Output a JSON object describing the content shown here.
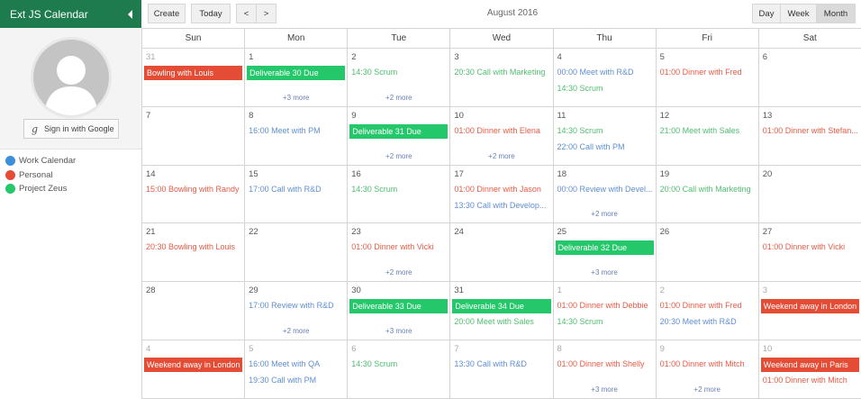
{
  "colors": {
    "work": "#3c8fd8",
    "personal": "#e44c36",
    "zeus": "#24c76a",
    "work_text": "#5f8fd0",
    "personal_text": "#e55b45",
    "zeus_text": "#4fbe6f"
  },
  "sidebar": {
    "title": "Ext JS Calendar",
    "collapse_icon": "caret-left-icon",
    "google_button": "Sign in with Google",
    "google_glyph": "g",
    "calendars": [
      {
        "label": "Work Calendar",
        "color": "#3c8fd8"
      },
      {
        "label": "Personal",
        "color": "#e44c36"
      },
      {
        "label": "Project Zeus",
        "color": "#24c76a"
      }
    ]
  },
  "toolbar": {
    "create": "Create",
    "today": "Today",
    "prev": "<",
    "next": ">",
    "title": "August 2016",
    "views": {
      "day": "Day",
      "week": "Week",
      "month": "Month"
    },
    "active_view": "Month"
  },
  "calendar": {
    "days_of_week": [
      "Sun",
      "Mon",
      "Tue",
      "Wed",
      "Thu",
      "Fri",
      "Sat"
    ],
    "weeks": [
      [
        {
          "day": "31",
          "other": true,
          "events": [
            {
              "title": "Bowling with Louis",
              "cal": "personal",
              "bar": true
            }
          ]
        },
        {
          "day": "1",
          "events": [
            {
              "title": "Deliverable 30 Due",
              "cal": "zeus",
              "bar": true
            }
          ],
          "more": "+3 more"
        },
        {
          "day": "2",
          "events": [
            {
              "title": "14:30 Scrum",
              "cal": "zeus"
            }
          ],
          "more": "+2 more"
        },
        {
          "day": "3",
          "events": [
            {
              "title": "20:30 Call with Marketing",
              "cal": "zeus"
            }
          ]
        },
        {
          "day": "4",
          "events": [
            {
              "title": "00:00 Meet with R&D",
              "cal": "work"
            },
            {
              "title": "14:30 Scrum",
              "cal": "zeus"
            }
          ]
        },
        {
          "day": "5",
          "events": [
            {
              "title": "01:00 Dinner with Fred",
              "cal": "personal"
            }
          ]
        },
        {
          "day": "6",
          "events": []
        }
      ],
      [
        {
          "day": "7",
          "events": []
        },
        {
          "day": "8",
          "events": [
            {
              "title": "16:00 Meet with PM",
              "cal": "work"
            }
          ]
        },
        {
          "day": "9",
          "events": [
            {
              "title": "Deliverable 31 Due",
              "cal": "zeus",
              "bar": true
            }
          ],
          "more": "+2 more"
        },
        {
          "day": "10",
          "events": [
            {
              "title": "01:00 Dinner with Elena",
              "cal": "personal"
            }
          ],
          "more": "+2 more"
        },
        {
          "day": "11",
          "events": [
            {
              "title": "14:30 Scrum",
              "cal": "zeus"
            },
            {
              "title": "22:00 Call with PM",
              "cal": "work"
            }
          ]
        },
        {
          "day": "12",
          "events": [
            {
              "title": "21:00 Meet with Sales",
              "cal": "zeus"
            }
          ]
        },
        {
          "day": "13",
          "events": [
            {
              "title": "01:00 Dinner with Stefan...",
              "cal": "personal"
            }
          ]
        }
      ],
      [
        {
          "day": "14",
          "events": [
            {
              "title": "15:00 Bowling with Randy",
              "cal": "personal"
            }
          ]
        },
        {
          "day": "15",
          "events": [
            {
              "title": "17:00 Call with R&D",
              "cal": "work"
            }
          ]
        },
        {
          "day": "16",
          "events": [
            {
              "title": "14:30 Scrum",
              "cal": "zeus"
            }
          ]
        },
        {
          "day": "17",
          "events": [
            {
              "title": "01:00 Dinner with Jason",
              "cal": "personal"
            },
            {
              "title": "13:30 Call with Develop...",
              "cal": "work"
            }
          ]
        },
        {
          "day": "18",
          "events": [
            {
              "title": "00:00 Review with Devel...",
              "cal": "work"
            }
          ],
          "more": "+2 more"
        },
        {
          "day": "19",
          "events": [
            {
              "title": "20:00 Call with Marketing",
              "cal": "zeus"
            }
          ]
        },
        {
          "day": "20",
          "events": []
        }
      ],
      [
        {
          "day": "21",
          "events": [
            {
              "title": "20:30 Bowling with Louis",
              "cal": "personal"
            }
          ]
        },
        {
          "day": "22",
          "events": []
        },
        {
          "day": "23",
          "events": [
            {
              "title": "01:00 Dinner with Vicki",
              "cal": "personal"
            }
          ],
          "more": "+2 more"
        },
        {
          "day": "24",
          "events": []
        },
        {
          "day": "25",
          "events": [
            {
              "title": "Deliverable 32 Due",
              "cal": "zeus",
              "bar": true
            }
          ],
          "more": "+3 more"
        },
        {
          "day": "26",
          "events": []
        },
        {
          "day": "27",
          "events": [
            {
              "title": "01:00 Dinner with Vicki",
              "cal": "personal"
            }
          ]
        }
      ],
      [
        {
          "day": "28",
          "events": []
        },
        {
          "day": "29",
          "events": [
            {
              "title": "17:00 Review with R&D",
              "cal": "work"
            }
          ],
          "more": "+2 more"
        },
        {
          "day": "30",
          "events": [
            {
              "title": "Deliverable 33 Due",
              "cal": "zeus",
              "bar": true
            }
          ],
          "more": "+3 more"
        },
        {
          "day": "31",
          "events": [
            {
              "title": "Deliverable 34 Due",
              "cal": "zeus",
              "bar": true
            },
            {
              "title": "20:00 Meet with Sales",
              "cal": "zeus"
            }
          ]
        },
        {
          "day": "1",
          "other": true,
          "events": [
            {
              "title": "01:00 Dinner with Debbie",
              "cal": "personal"
            },
            {
              "title": "14:30 Scrum",
              "cal": "zeus"
            }
          ]
        },
        {
          "day": "2",
          "other": true,
          "events": [
            {
              "title": "01:00 Dinner with Fred",
              "cal": "personal"
            },
            {
              "title": "20:30 Meet with R&D",
              "cal": "work"
            }
          ]
        },
        {
          "day": "3",
          "other": true,
          "events": [
            {
              "title": "Weekend away in London",
              "cal": "personal",
              "bar": true
            }
          ]
        }
      ],
      [
        {
          "day": "4",
          "other": true,
          "events": [
            {
              "title": "Weekend away in London",
              "cal": "personal",
              "bar": true
            }
          ]
        },
        {
          "day": "5",
          "other": true,
          "events": [
            {
              "title": "16:00 Meet with QA",
              "cal": "work"
            },
            {
              "title": "19:30 Call with PM",
              "cal": "work"
            }
          ]
        },
        {
          "day": "6",
          "other": true,
          "events": [
            {
              "title": "14:30 Scrum",
              "cal": "zeus"
            }
          ]
        },
        {
          "day": "7",
          "other": true,
          "events": [
            {
              "title": "13:30 Call with R&D",
              "cal": "work"
            }
          ]
        },
        {
          "day": "8",
          "other": true,
          "events": [
            {
              "title": "01:00 Dinner with Shelly",
              "cal": "personal"
            }
          ],
          "more": "+3 more"
        },
        {
          "day": "9",
          "other": true,
          "events": [
            {
              "title": "01:00 Dinner with Mitch",
              "cal": "personal"
            }
          ],
          "more": "+2 more"
        },
        {
          "day": "10",
          "other": true,
          "events": [
            {
              "title": "Weekend away in Paris",
              "cal": "personal",
              "bar": true
            },
            {
              "title": "01:00 Dinner with Mitch",
              "cal": "personal"
            }
          ]
        }
      ]
    ]
  }
}
